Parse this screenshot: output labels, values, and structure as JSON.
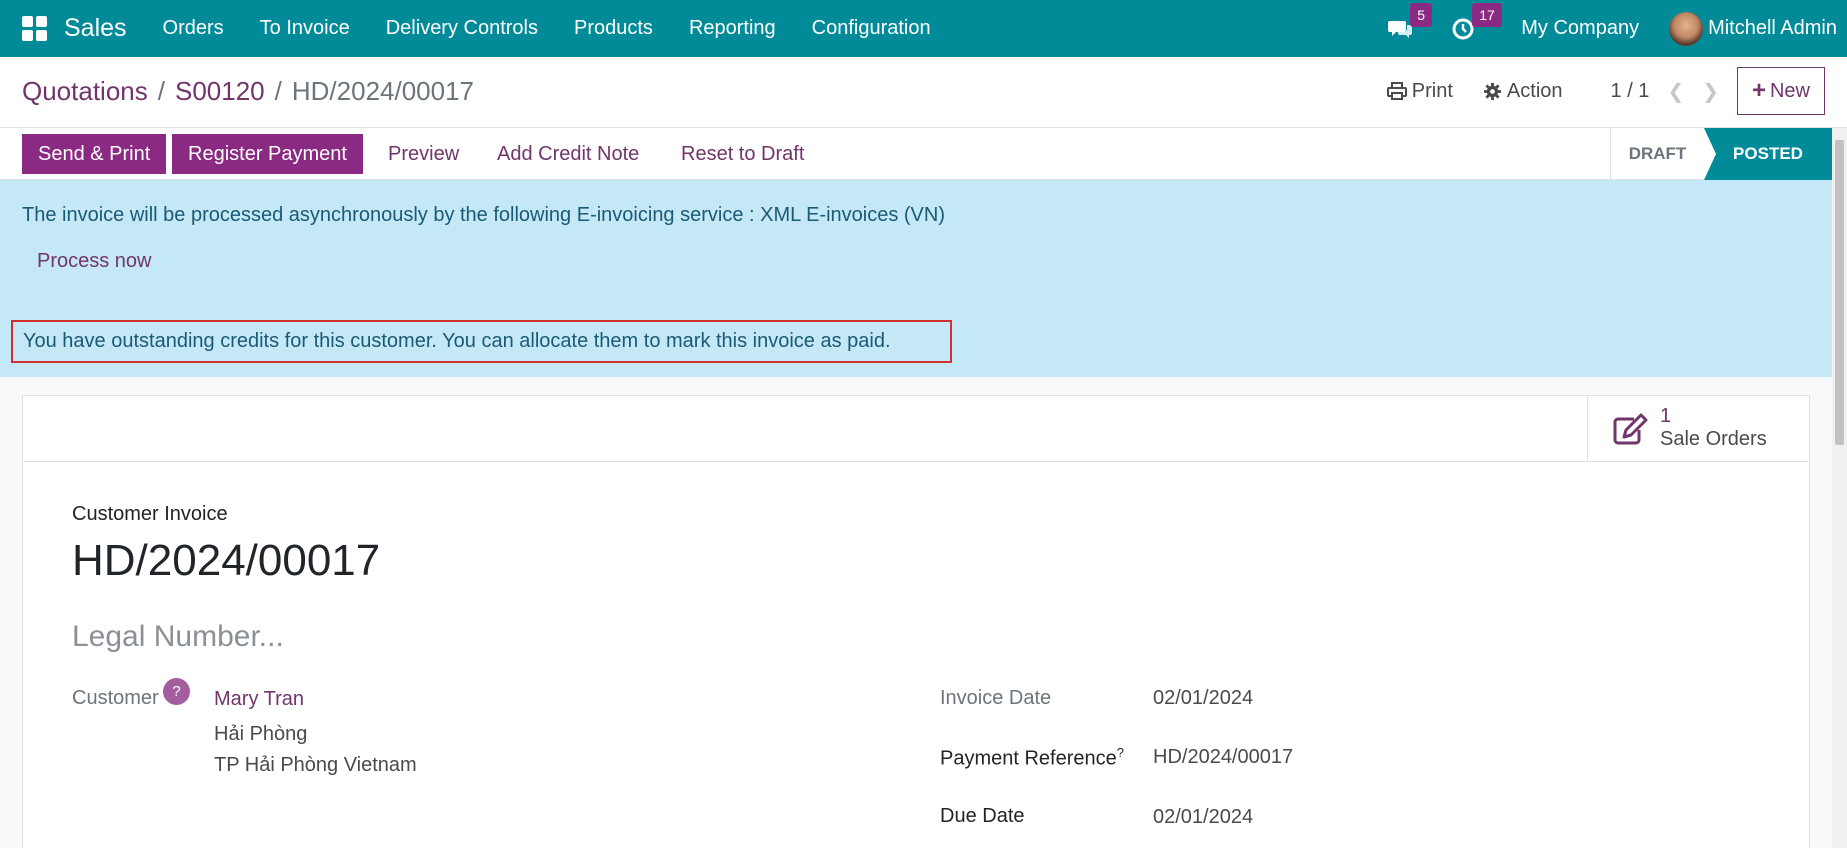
{
  "navbar": {
    "app_name": "Sales",
    "menu": [
      "Orders",
      "To Invoice",
      "Delivery Controls",
      "Products",
      "Reporting",
      "Configuration"
    ],
    "messages_count": "5",
    "activities_count": "17",
    "company": "My Company",
    "user": "Mitchell Admin"
  },
  "breadcrumb": {
    "items": [
      "Quotations",
      "S00120"
    ],
    "current": "HD/2024/00017"
  },
  "control": {
    "print": "Print",
    "action": "Action",
    "pager": "1 / 1",
    "new": "New"
  },
  "actions": {
    "send_print": "Send & Print",
    "register_payment": "Register Payment",
    "preview": "Preview",
    "add_credit_note": "Add Credit Note",
    "reset_to_draft": "Reset to Draft"
  },
  "status": {
    "draft": "DRAFT",
    "posted": "POSTED",
    "current": "POSTED"
  },
  "alert": {
    "message": "The invoice will be processed asynchronously by the following E-invoicing service : XML E-invoices (VN)",
    "process_now": "Process now",
    "credits": "You have outstanding credits for this customer. You can allocate them to mark this invoice as paid."
  },
  "smart_button": {
    "value": "1",
    "label": "Sale Orders"
  },
  "form": {
    "type": "Customer Invoice",
    "name": "HD/2024/00017",
    "legal_placeholder": "Legal Number...",
    "customer_label": "Customer",
    "help_mark": "?",
    "customer_name": "Mary Tran",
    "address_line1": "Hải Phòng",
    "address_line2": "TP Hải Phòng Vietnam",
    "invoice_date_label": "Invoice Date",
    "invoice_date": "02/01/2024",
    "payment_ref_label": "Payment Reference",
    "payment_ref_help": "?",
    "payment_ref": "HD/2024/00017",
    "due_date_label": "Due Date",
    "due_date": "02/01/2024"
  },
  "colors": {
    "navbar": "#018b98",
    "primary": "#8b2a83",
    "link": "#71356a",
    "alert_bg": "#c5e8f7",
    "highlight_border": "#d32f2f"
  }
}
